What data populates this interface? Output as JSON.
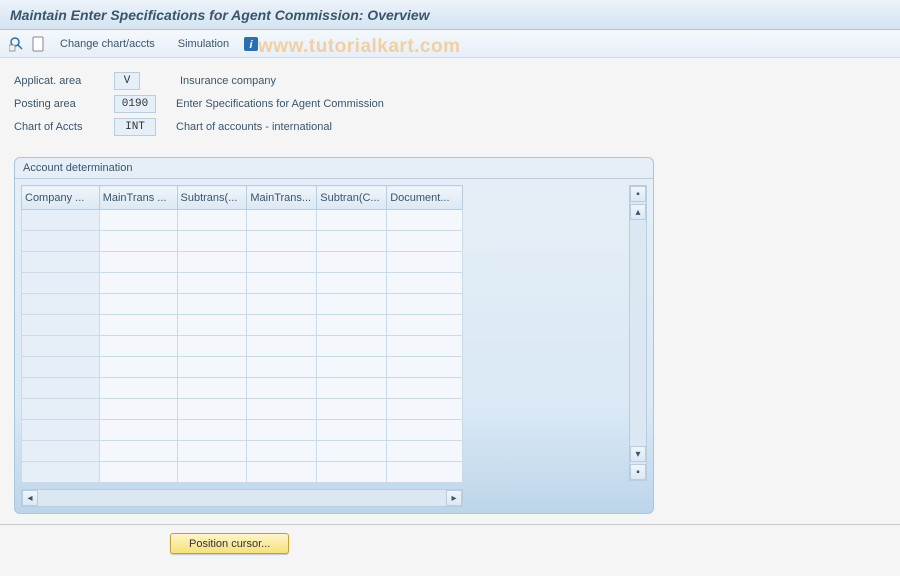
{
  "title": "Maintain Enter Specifications for Agent Commission: Overview",
  "toolbar": {
    "change_link": "Change chart/accts",
    "simulation_link": "Simulation"
  },
  "form": {
    "app_area": {
      "label": "Applicat. area",
      "value": "V",
      "desc": "Insurance company"
    },
    "posting_area": {
      "label": "Posting area",
      "value": "0190",
      "desc": "Enter Specifications for Agent Commission"
    },
    "chart_accts": {
      "label": "Chart of Accts",
      "value": "INT",
      "desc": "Chart of accounts - international"
    }
  },
  "panel": {
    "title": "Account determination",
    "cols": [
      "Company ...",
      "MainTrans ...",
      "Subtrans(...",
      "MainTrans...",
      "Subtran(C...",
      "Document..."
    ]
  },
  "button": {
    "position": "Position cursor..."
  },
  "watermark": "www.tutorialkart.com"
}
